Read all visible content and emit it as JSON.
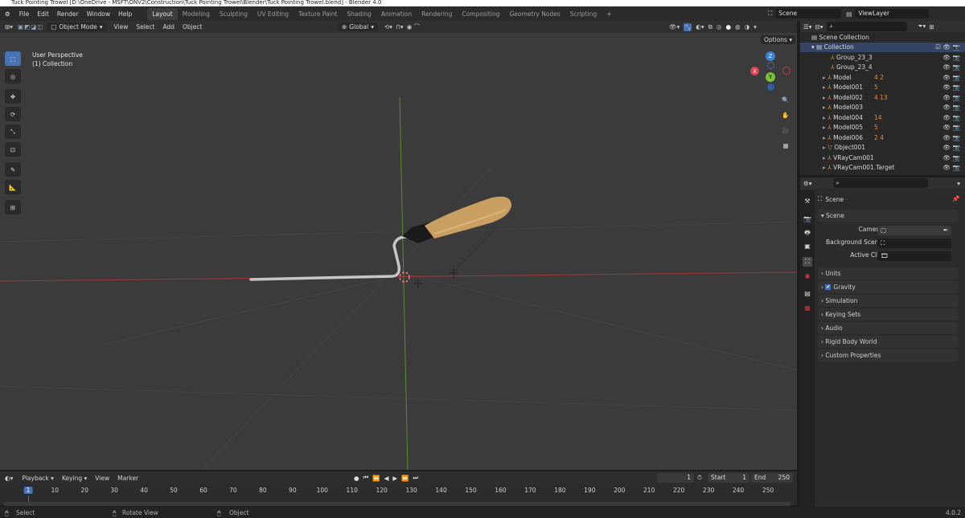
{
  "window_title": "Tuck Pointing Trowel [D:\\OneDrive - MSFT\\ONV2\\Construction\\Tuck Pointing Trowel\\Blender\\Tuck Pointing Trowel.blend] - Blender 4.0",
  "menu": [
    "File",
    "Edit",
    "Render",
    "Window",
    "Help"
  ],
  "workspaces": [
    "Layout",
    "Modeling",
    "Sculpting",
    "UV Editing",
    "Texture Paint",
    "Shading",
    "Animation",
    "Rendering",
    "Compositing",
    "Geometry Nodes",
    "Scripting"
  ],
  "active_workspace": "Layout",
  "scene_name": "Scene",
  "view_layer": "ViewLayer",
  "viewport_header": {
    "mode": "Object Mode",
    "items": [
      "View",
      "Select",
      "Add",
      "Object"
    ],
    "transform_orientation": "Global",
    "options_label": "Options"
  },
  "viewport": {
    "perspective": "User Perspective",
    "collection": "(1) Collection",
    "gizmo_axes": {
      "z": "Z",
      "y": "Y",
      "x": "X"
    }
  },
  "outliner": {
    "root": "Scene Collection",
    "collection": "Collection",
    "items": [
      {
        "name": "Group_23_3",
        "badge": ""
      },
      {
        "name": "Group_23_4",
        "badge": ""
      },
      {
        "name": "Model",
        "badge": "4  2"
      },
      {
        "name": "Model001",
        "badge": "5"
      },
      {
        "name": "Model002",
        "badge": "4  13"
      },
      {
        "name": "Model003",
        "badge": ""
      },
      {
        "name": "Model004",
        "badge": "14"
      },
      {
        "name": "Model005",
        "badge": "5"
      },
      {
        "name": "Model006",
        "badge": "2  4"
      },
      {
        "name": "Object001",
        "badge": ""
      },
      {
        "name": "VRayCam001",
        "badge": ""
      },
      {
        "name": "VRayCam001.Target",
        "badge": ""
      }
    ]
  },
  "properties": {
    "context": "Scene",
    "section": "Scene",
    "fields": {
      "camera_label": "Camera",
      "background_label": "Background Scene",
      "clip_label": "Active Clip"
    },
    "panels": [
      "Units",
      "Gravity",
      "Simulation",
      "Keying Sets",
      "Audio",
      "Rigid Body World",
      "Custom Properties"
    ]
  },
  "timeline": {
    "menus": [
      "Playback",
      "Keying",
      "View",
      "Marker"
    ],
    "current_frame": "1",
    "start_label": "Start",
    "start": "1",
    "end_label": "End",
    "end": "250",
    "ticks": [
      "1",
      "10",
      "20",
      "30",
      "40",
      "50",
      "60",
      "70",
      "80",
      "90",
      "100",
      "110",
      "120",
      "130",
      "140",
      "150",
      "160",
      "170",
      "180",
      "190",
      "200",
      "210",
      "220",
      "230",
      "240",
      "250"
    ]
  },
  "statusbar": {
    "select": "Select",
    "rotate": "Rotate View",
    "object": "Object",
    "version": "4.0.2"
  },
  "colors": {
    "accent": "#4772b3",
    "x_axis": "#e04050",
    "y_axis": "#7bbf3a",
    "z_axis": "#3a7fd8",
    "handle": "#c9974a"
  }
}
